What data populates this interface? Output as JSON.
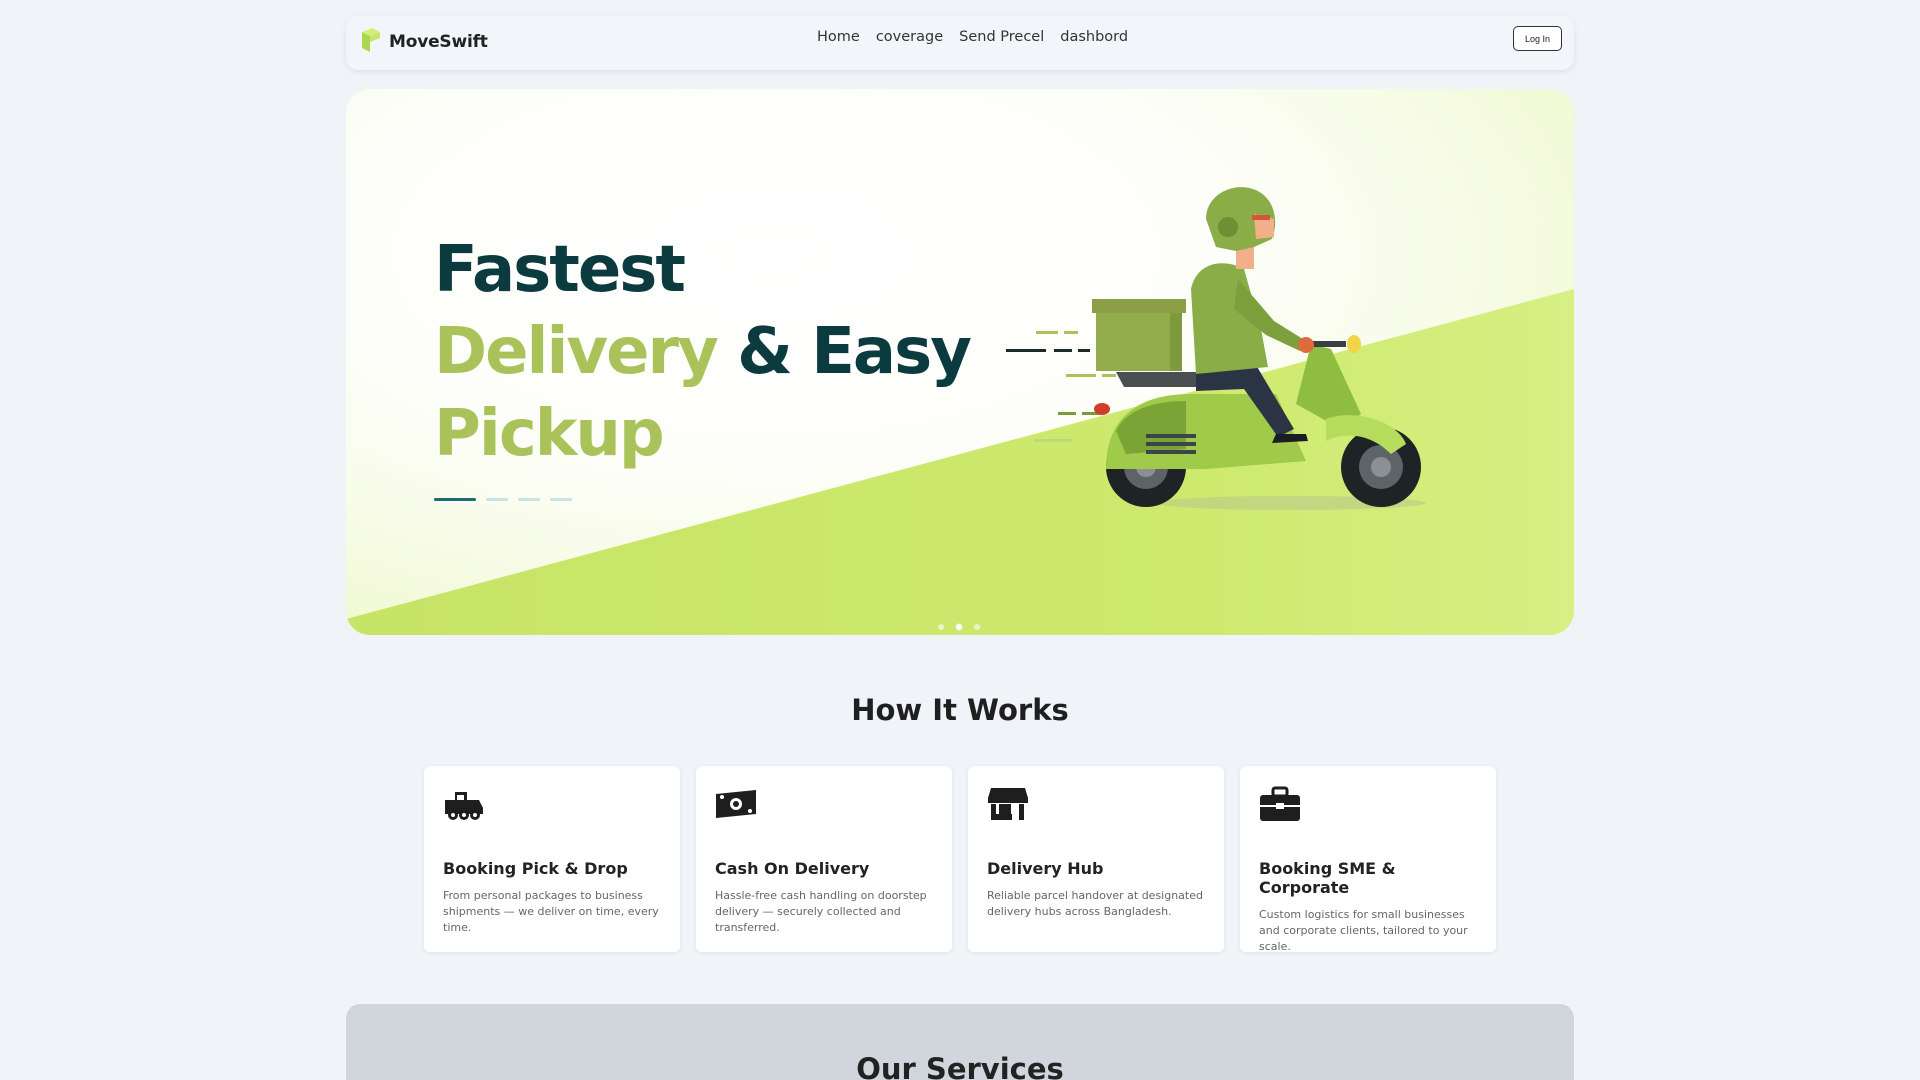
{
  "nav": {
    "brand": "MoveSwift",
    "links": [
      "Home",
      "coverage",
      "Send Precel",
      "dashbord"
    ],
    "login_label": "Log In"
  },
  "hero": {
    "line1": "Fastest",
    "line2_accent": "Delivery",
    "line2_rest": " & Easy",
    "line3": "Pickup",
    "active_slide": 2,
    "slide_count": 3
  },
  "how_it_works": {
    "title": "How It Works",
    "cards": [
      {
        "icon": "truck-icon",
        "title": "Booking Pick & Drop",
        "desc": "From personal packages to business shipments — we deliver on time, every time."
      },
      {
        "icon": "money-bill-icon",
        "title": "Cash On Delivery",
        "desc": "Hassle-free cash handling on doorstep delivery — securely collected and transferred."
      },
      {
        "icon": "store-icon",
        "title": "Delivery Hub",
        "desc": "Reliable parcel handover at designated delivery hubs across Bangladesh."
      },
      {
        "icon": "briefcase-icon",
        "title": "Booking SME & Corporate",
        "desc": "Custom logistics for small businesses and corporate clients, tailored to your scale."
      }
    ]
  },
  "services": {
    "title": "Our Services"
  },
  "colors": {
    "brand_green": "#a9c35a",
    "lime": "#c9e86a",
    "dark_teal": "#0b3a3f",
    "page_bg": "#f0f3f8"
  }
}
